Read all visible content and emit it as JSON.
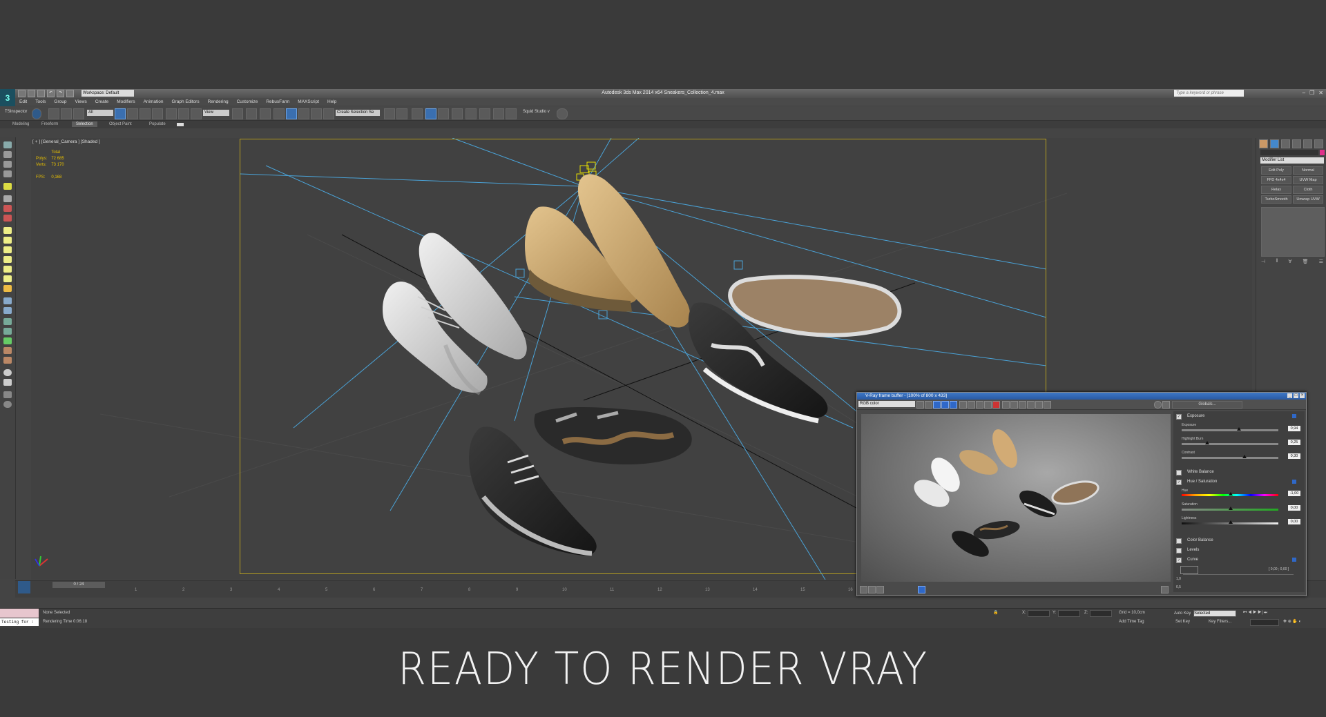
{
  "app": {
    "title": "Autodesk 3ds Max  2014 x64     Sneakers_Collection_4.max",
    "workspace": "Workspace: Default",
    "search_placeholder": "Type a keyword or phrase",
    "logo": "3"
  },
  "menu": [
    "Edit",
    "Tools",
    "Group",
    "Views",
    "Create",
    "Modifiers",
    "Animation",
    "Graph Editors",
    "Rendering",
    "Customize",
    "RebusFarm",
    "MAXScript",
    "Help"
  ],
  "toolbar": {
    "inspector": "TSInspector",
    "filter": "All",
    "view_dropdown": "View",
    "selection_set": "Create Selection Se",
    "squid": "Squid Studio v"
  },
  "ribbon": {
    "tabs": [
      "Modeling",
      "Freeform",
      "Selection",
      "Object Paint",
      "Populate"
    ],
    "active": "Selection"
  },
  "viewport": {
    "label": "[ + ] [General_Camera ] [Shaded ]",
    "stats": {
      "header": "Total",
      "polys_label": "Polys:",
      "polys": "72 685",
      "verts_label": "Verts:",
      "verts": "73 170",
      "fps_label": "FPS:",
      "fps": "0,168"
    }
  },
  "command_panel": {
    "modifier_list": "Modifier List",
    "buttons": [
      "Edit Poly",
      "Normal",
      "FFD 4x4x4",
      "UVW Map",
      "Relax",
      "Cloth",
      "TurboSmooth",
      "Unwrap UVW"
    ]
  },
  "timeline": {
    "slider": "0 / 24",
    "ticks": [
      "1",
      "2",
      "3",
      "4",
      "5",
      "6",
      "7",
      "8",
      "9",
      "10",
      "11",
      "12",
      "13",
      "14",
      "15",
      "16"
    ]
  },
  "status": {
    "selection": "None Selected",
    "render_time": "Rendering Time  0:06:18",
    "maxscript": "Testing for :",
    "x_label": "X:",
    "y_label": "Y:",
    "z_label": "Z:",
    "grid": "Grid = 10,0cm",
    "add_time_tag": "Add Time Tag",
    "auto_key": "Auto Key",
    "auto_key_mode": "Selected",
    "set_key": "Set Key",
    "key_filters": "Key Filters..."
  },
  "vfb": {
    "title": "V-Ray frame buffer - [100% of 800 x 433]",
    "channel": "RGB color",
    "globals": "Globals...",
    "exposure": {
      "label": "Exposure",
      "exposure_label": "Exposure",
      "exposure": "0,94",
      "highlight_label": "Highlight Burn",
      "highlight": "0,25",
      "contrast_label": "Contrast",
      "contrast": "0,30"
    },
    "white_balance": "White Balance",
    "hue_sat": {
      "label": "Hue / Saturation",
      "hue_label": "Hue",
      "hue": "-1,00",
      "sat_label": "Saturation",
      "sat": "0,00",
      "light_label": "Lightness",
      "light": "0,00"
    },
    "color_balance": "Color Balance",
    "levels": "Levels",
    "curve": {
      "label": "Curve",
      "coords": "[ 0,00 ; 0,00 ]",
      "y_top": "1,0",
      "y_mid": "0,5"
    }
  },
  "caption": "READY TO RENDER  VRAY",
  "colors": {
    "camera_frame": "#b8a020",
    "stats": "#e8c000",
    "vfb_title": "#3c77c6",
    "caption": "#f2f2f2"
  }
}
